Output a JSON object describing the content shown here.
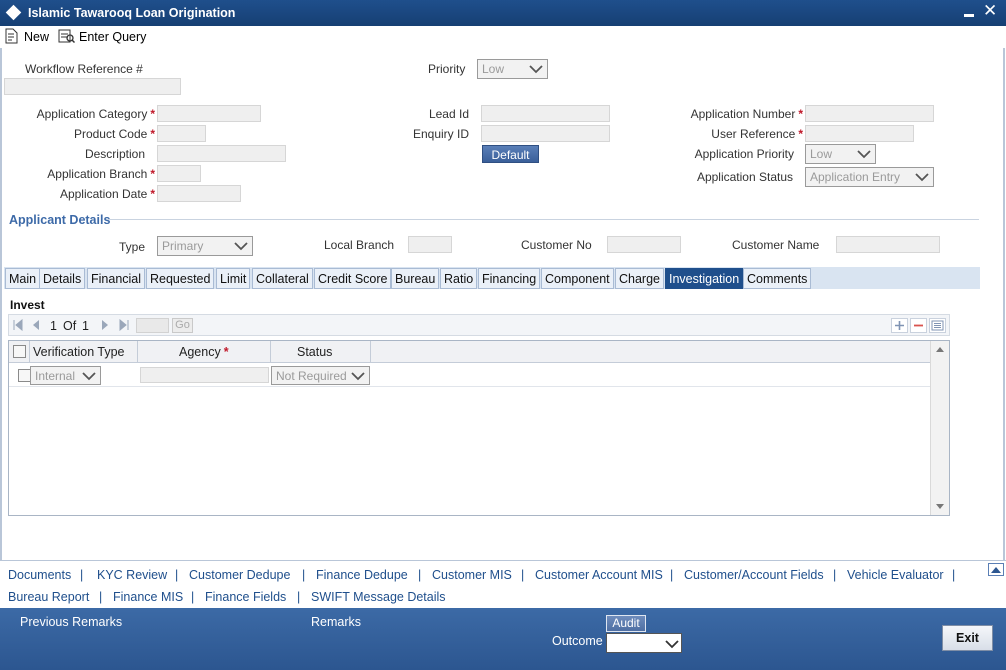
{
  "window": {
    "title": "Islamic Tawarooq Loan Origination"
  },
  "toolbar": {
    "new_label": "New",
    "enter_query_label": "Enter Query"
  },
  "header": {
    "workflow_ref_label": "Workflow Reference #",
    "priority_label": "Priority",
    "priority_value": "Low",
    "app_category_label": "Application Category",
    "product_code_label": "Product Code",
    "description_label": "Description",
    "app_branch_label": "Application Branch",
    "app_date_label": "Application Date",
    "lead_id_label": "Lead Id",
    "enquiry_id_label": "Enquiry ID",
    "default_button": "Default",
    "app_number_label": "Application Number",
    "user_ref_label": "User Reference",
    "app_priority_label": "Application Priority",
    "app_priority_value": "Low",
    "app_status_label": "Application Status",
    "app_status_value": "Application Entry",
    "required_marker": "*"
  },
  "applicant": {
    "section_title": "Applicant Details",
    "type_label": "Type",
    "type_value": "Primary",
    "local_branch_label": "Local Branch",
    "customer_no_label": "Customer No",
    "customer_name_label": "Customer Name"
  },
  "tabs": [
    {
      "label": "Main"
    },
    {
      "label": "Details"
    },
    {
      "label": "Financial"
    },
    {
      "label": "Requested"
    },
    {
      "label": "Limit"
    },
    {
      "label": "Collateral"
    },
    {
      "label": "Credit Score"
    },
    {
      "label": "Bureau"
    },
    {
      "label": "Ratio"
    },
    {
      "label": "Financing"
    },
    {
      "label": "Component"
    },
    {
      "label": "Charge"
    },
    {
      "label": "Investigation"
    },
    {
      "label": "Comments"
    }
  ],
  "active_tab": "Investigation",
  "invest": {
    "section_title": "Invest",
    "pager_current": "1",
    "pager_of": "Of",
    "pager_total": "1",
    "go_label": "Go",
    "columns": [
      "Verification Type",
      "Agency",
      "Status"
    ],
    "row": {
      "verification_type": "Internal",
      "status": "Not Required"
    }
  },
  "links_row1": [
    "Documents",
    "KYC Review",
    "Customer Dedupe",
    "Finance Dedupe",
    "Customer MIS",
    "Customer Account MIS",
    "Customer/Account Fields",
    "Vehicle Evaluator"
  ],
  "links_row2": [
    "Bureau Report",
    "Finance MIS",
    "Finance Fields",
    "SWIFT Message Details"
  ],
  "link_separator": "|",
  "footer": {
    "previous_remarks_label": "Previous Remarks",
    "remarks_label": "Remarks",
    "audit_button": "Audit",
    "outcome_label": "Outcome",
    "exit_button": "Exit"
  },
  "colors": {
    "title_bar": "#1f4f8c",
    "link": "#1f4f8c",
    "required": "#c0192a",
    "section_title": "#3d6aa8",
    "footer": "#3c6aa6"
  },
  "icons": {
    "title": "diamond-icon",
    "new": "new-document-icon",
    "enter_query": "enter-query-icon",
    "minimize": "minimize-icon",
    "close": "close-icon",
    "scroll_up": "scroll-up-icon"
  }
}
